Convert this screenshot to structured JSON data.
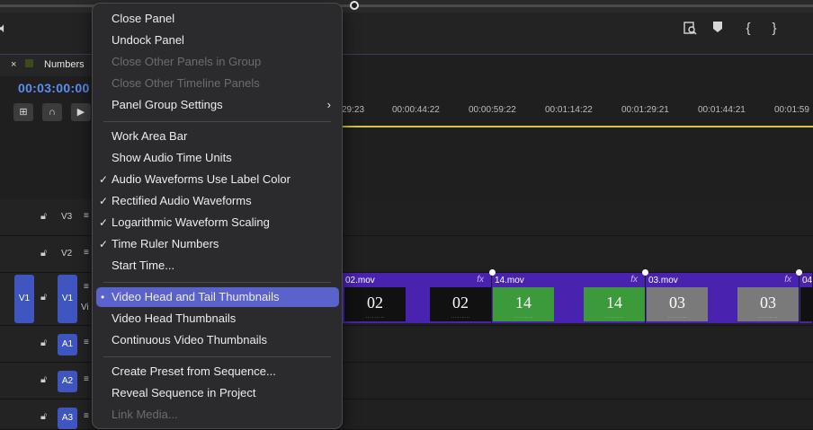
{
  "toolbar": {
    "volume_icon": "speaker-icon",
    "right_icons": [
      "search-panel-icon",
      "marker-icon",
      "mark-in-icon",
      "mark-out-icon"
    ],
    "mark_in_glyph": "{",
    "mark_out_glyph": "}"
  },
  "panel": {
    "tab_close": "×",
    "tab_title": "Numbers",
    "timecode": "00:03:00:00",
    "ruler": [
      "29:23",
      "00:00:44:22",
      "00:00:59:22",
      "00:01:14:22",
      "00:01:29:21",
      "00:01:44:21",
      "00:01:59"
    ],
    "tracks": {
      "v3": "V3",
      "v2": "V2",
      "v1_src": "V1",
      "v1": "V1",
      "v1_name": "Vi",
      "a1": "A1",
      "a2": "A2",
      "a3": "A3"
    },
    "clips": [
      {
        "name": "02.mov",
        "fx": "fx",
        "head": "02",
        "tail": "02",
        "color": "black"
      },
      {
        "name": "14.mov",
        "fx": "fx",
        "head": "14",
        "tail": "14",
        "color": "green"
      },
      {
        "name": "03.mov",
        "fx": "fx",
        "head": "03",
        "tail": "03",
        "color": "grey"
      },
      {
        "name": "04",
        "fx": "",
        "head": "",
        "tail": "",
        "color": "black"
      }
    ]
  },
  "menu": {
    "items": [
      {
        "label": "Close Panel",
        "check": "",
        "disabled": false
      },
      {
        "label": "Undock Panel",
        "check": "",
        "disabled": false
      },
      {
        "label": "Close Other Panels in Group",
        "check": "",
        "disabled": true
      },
      {
        "label": "Close Other Timeline Panels",
        "check": "",
        "disabled": true
      },
      {
        "label": "Panel Group Settings",
        "check": "",
        "disabled": false,
        "submenu": true
      },
      {
        "label": "Work Area Bar",
        "check": "",
        "disabled": false
      },
      {
        "label": "Show Audio Time Units",
        "check": "",
        "disabled": false
      },
      {
        "label": "Audio Waveforms Use Label Color",
        "check": "✓",
        "disabled": false
      },
      {
        "label": "Rectified Audio Waveforms",
        "check": "✓",
        "disabled": false
      },
      {
        "label": "Logarithmic Waveform Scaling",
        "check": "✓",
        "disabled": false
      },
      {
        "label": "Time Ruler Numbers",
        "check": "✓",
        "disabled": false
      },
      {
        "label": "Start Time...",
        "check": "",
        "disabled": false
      },
      {
        "label": "Video Head and Tail Thumbnails",
        "check": "•",
        "disabled": false,
        "selected": true
      },
      {
        "label": "Video Head Thumbnails",
        "check": "",
        "disabled": false
      },
      {
        "label": "Continuous Video Thumbnails",
        "check": "",
        "disabled": false
      },
      {
        "label": "Create Preset from Sequence...",
        "check": "",
        "disabled": false
      },
      {
        "label": "Reveal Sequence in Project",
        "check": "",
        "disabled": false
      },
      {
        "label": "Link Media...",
        "check": "",
        "disabled": true
      }
    ],
    "submenu_arrow": "›"
  }
}
